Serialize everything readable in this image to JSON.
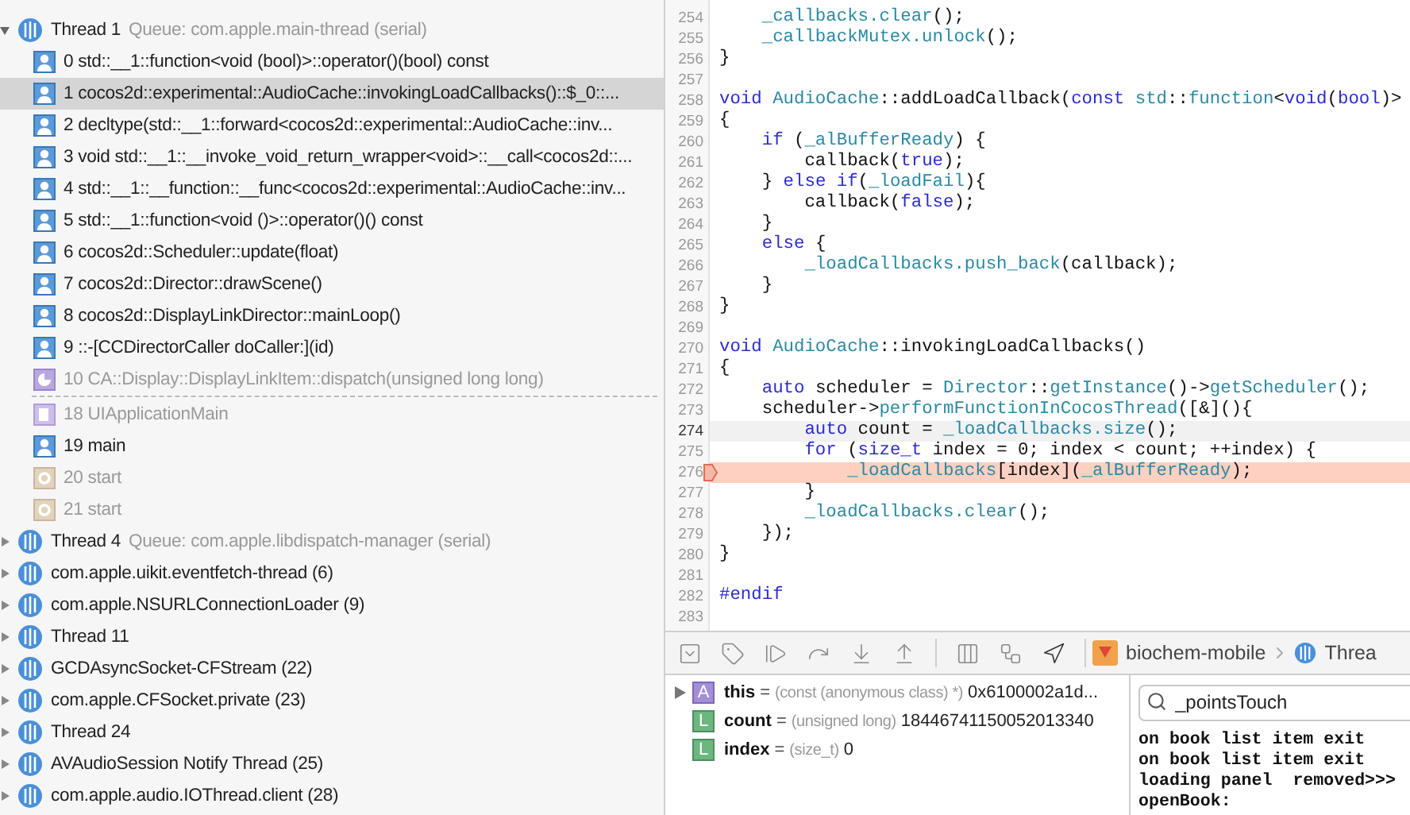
{
  "navigator": {
    "threads": [
      {
        "name": "Thread 1",
        "queue": "Queue: com.apple.main-thread (serial)",
        "expanded": true,
        "frames": [
          {
            "kind": "user",
            "label": "0 std::__1::function<void (bool)>::operator()(bool) const",
            "selected": false
          },
          {
            "kind": "user",
            "label": "1 cocos2d::experimental::AudioCache::invokingLoadCallbacks()::$_0::...",
            "selected": true
          },
          {
            "kind": "user",
            "label": "2 decltype(std::__1::forward<cocos2d::experimental::AudioCache::inv...",
            "selected": false
          },
          {
            "kind": "user",
            "label": "3 void std::__1::__invoke_void_return_wrapper<void>::__call<cocos2d::...",
            "selected": false
          },
          {
            "kind": "user",
            "label": "4 std::__1::__function::__func<cocos2d::experimental::AudioCache::inv...",
            "selected": false
          },
          {
            "kind": "user",
            "label": "5 std::__1::function<void ()>::operator()() const",
            "selected": false
          },
          {
            "kind": "user",
            "label": "6 cocos2d::Scheduler::update(float)",
            "selected": false
          },
          {
            "kind": "user",
            "label": "7 cocos2d::Director::drawScene()",
            "selected": false
          },
          {
            "kind": "user",
            "label": "8 cocos2d::DisplayLinkDirector::mainLoop()",
            "selected": false
          },
          {
            "kind": "user",
            "label": "9 ::-[CCDirectorCaller doCaller:](id)",
            "selected": false
          },
          {
            "kind": "quartz",
            "label": "10 CA::Display::DisplayLinkItem::dispatch(unsigned long long)",
            "selected": false
          },
          {
            "kind": "elision"
          },
          {
            "kind": "library",
            "label": "18 UIApplicationMain",
            "selected": false
          },
          {
            "kind": "user",
            "label": "19 main",
            "selected": false
          },
          {
            "kind": "system",
            "label": "20 start",
            "selected": false
          },
          {
            "kind": "system",
            "label": "21 start",
            "selected": false
          }
        ]
      },
      {
        "name": "Thread 4",
        "queue": "Queue: com.apple.libdispatch-manager (serial)",
        "expanded": false
      },
      {
        "name": "com.apple.uikit.eventfetch-thread (6)",
        "expanded": false
      },
      {
        "name": "com.apple.NSURLConnectionLoader (9)",
        "expanded": false
      },
      {
        "name": "Thread 11",
        "expanded": false
      },
      {
        "name": "GCDAsyncSocket-CFStream (22)",
        "expanded": false
      },
      {
        "name": "com.apple.CFSocket.private (23)",
        "expanded": false
      },
      {
        "name": "Thread 24",
        "expanded": false
      },
      {
        "name": "AVAudioSession Notify Thread (25)",
        "expanded": false
      },
      {
        "name": "com.apple.audio.IOThread.client (28)",
        "expanded": false
      }
    ]
  },
  "editor": {
    "lines": [
      {
        "number": "254",
        "current": false,
        "stopped": false,
        "parts": [
          {
            "text": "    _callbacks.clear",
            "kind": "symbol"
          },
          {
            "text": "();",
            "kind": "plain"
          }
        ]
      },
      {
        "number": "255",
        "current": false,
        "stopped": false,
        "parts": [
          {
            "text": "    _callbackMutex.unlock",
            "kind": "symbol"
          },
          {
            "text": "();",
            "kind": "plain"
          }
        ]
      },
      {
        "number": "256",
        "current": false,
        "stopped": false,
        "parts": [
          {
            "text": "}",
            "kind": "plain"
          }
        ]
      },
      {
        "number": "257",
        "current": false,
        "stopped": false
      },
      {
        "number": "258",
        "current": false,
        "stopped": false,
        "parts": [
          {
            "text": "void ",
            "kind": "keyword"
          },
          {
            "text": "AudioCache",
            "kind": "symbol"
          },
          {
            "text": "::addLoadCallback(",
            "kind": "plain"
          },
          {
            "text": "const ",
            "kind": "keyword"
          },
          {
            "text": "std",
            "kind": "symbol"
          },
          {
            "text": "::",
            "kind": "plain"
          },
          {
            "text": "function",
            "kind": "symbol"
          },
          {
            "text": "<",
            "kind": "plain"
          },
          {
            "text": "void",
            "kind": "keyword"
          },
          {
            "text": "(",
            "kind": "plain"
          },
          {
            "text": "bool",
            "kind": "keyword"
          },
          {
            "text": ")>",
            "kind": "plain"
          }
        ]
      },
      {
        "number": "259",
        "current": false,
        "stopped": false,
        "parts": [
          {
            "text": "{",
            "kind": "plain"
          }
        ]
      },
      {
        "number": "260",
        "current": false,
        "stopped": false,
        "parts": [
          {
            "text": "    if ",
            "kind": "keyword"
          },
          {
            "text": "(",
            "kind": "plain"
          },
          {
            "text": "_alBufferReady",
            "kind": "symbol"
          },
          {
            "text": ") {",
            "kind": "plain"
          }
        ]
      },
      {
        "number": "261",
        "current": false,
        "stopped": false,
        "parts": [
          {
            "text": "        callback(",
            "kind": "plain"
          },
          {
            "text": "true",
            "kind": "keyword"
          },
          {
            "text": ");",
            "kind": "plain"
          }
        ]
      },
      {
        "number": "262",
        "current": false,
        "stopped": false,
        "parts": [
          {
            "text": "    } ",
            "kind": "plain"
          },
          {
            "text": "else if",
            "kind": "keyword"
          },
          {
            "text": "(",
            "kind": "plain"
          },
          {
            "text": "_loadFail",
            "kind": "symbol"
          },
          {
            "text": "){",
            "kind": "plain"
          }
        ]
      },
      {
        "number": "263",
        "current": false,
        "stopped": false,
        "parts": [
          {
            "text": "        callback(",
            "kind": "plain"
          },
          {
            "text": "false",
            "kind": "keyword"
          },
          {
            "text": ");",
            "kind": "plain"
          }
        ]
      },
      {
        "number": "264",
        "current": false,
        "stopped": false,
        "parts": [
          {
            "text": "    }",
            "kind": "plain"
          }
        ]
      },
      {
        "number": "265",
        "current": false,
        "stopped": false,
        "parts": [
          {
            "text": "    else ",
            "kind": "keyword"
          },
          {
            "text": "{",
            "kind": "plain"
          }
        ]
      },
      {
        "number": "266",
        "current": false,
        "stopped": false,
        "parts": [
          {
            "text": "        _loadCallbacks.push_back",
            "kind": "symbol"
          },
          {
            "text": "(callback);",
            "kind": "plain"
          }
        ]
      },
      {
        "number": "267",
        "current": false,
        "stopped": false,
        "parts": [
          {
            "text": "    }",
            "kind": "plain"
          }
        ]
      },
      {
        "number": "268",
        "current": false,
        "stopped": false,
        "parts": [
          {
            "text": "}",
            "kind": "plain"
          }
        ]
      },
      {
        "number": "269",
        "current": false,
        "stopped": false
      },
      {
        "number": "270",
        "current": false,
        "stopped": false,
        "parts": [
          {
            "text": "void ",
            "kind": "keyword"
          },
          {
            "text": "AudioCache",
            "kind": "symbol"
          },
          {
            "text": "::invokingLoadCallbacks()",
            "kind": "plain"
          }
        ]
      },
      {
        "number": "271",
        "current": false,
        "stopped": false,
        "parts": [
          {
            "text": "{",
            "kind": "plain"
          }
        ]
      },
      {
        "number": "272",
        "current": false,
        "stopped": false,
        "parts": [
          {
            "text": "    auto ",
            "kind": "keyword"
          },
          {
            "text": "scheduler = ",
            "kind": "plain"
          },
          {
            "text": "Director",
            "kind": "symbol"
          },
          {
            "text": "::",
            "kind": "plain"
          },
          {
            "text": "getInstance",
            "kind": "symbol"
          },
          {
            "text": "()->",
            "kind": "plain"
          },
          {
            "text": "getScheduler",
            "kind": "symbol"
          },
          {
            "text": "();",
            "kind": "plain"
          }
        ]
      },
      {
        "number": "273",
        "current": false,
        "stopped": false,
        "parts": [
          {
            "text": "    scheduler->",
            "kind": "plain"
          },
          {
            "text": "performFunctionInCocosThread",
            "kind": "symbol"
          },
          {
            "text": "([&](){",
            "kind": "plain"
          }
        ]
      },
      {
        "number": "274",
        "current": true,
        "stopped": false,
        "parts": [
          {
            "text": "        auto ",
            "kind": "keyword"
          },
          {
            "text": "count = ",
            "kind": "plain"
          },
          {
            "text": "_loadCallbacks.size",
            "kind": "symbol"
          },
          {
            "text": "();",
            "kind": "plain"
          }
        ]
      },
      {
        "number": "275",
        "current": false,
        "stopped": false,
        "parts": [
          {
            "text": "        for ",
            "kind": "keyword"
          },
          {
            "text": "(",
            "kind": "plain"
          },
          {
            "text": "size_t",
            "kind": "keyword"
          },
          {
            "text": " index = 0; index < count; ++index) {",
            "kind": "plain"
          }
        ]
      },
      {
        "number": "276",
        "current": false,
        "stopped": true,
        "parts": [
          {
            "text": "            _loadCallbacks",
            "kind": "symbol"
          },
          {
            "text": "[index](",
            "kind": "plain"
          },
          {
            "text": "_alBufferReady",
            "kind": "symbol"
          },
          {
            "text": ");",
            "kind": "plain"
          }
        ]
      },
      {
        "number": "277",
        "current": false,
        "stopped": false,
        "parts": [
          {
            "text": "        }",
            "kind": "plain"
          }
        ]
      },
      {
        "number": "278",
        "current": false,
        "stopped": false,
        "parts": [
          {
            "text": "        _loadCallbacks.clear",
            "kind": "symbol"
          },
          {
            "text": "();",
            "kind": "plain"
          }
        ]
      },
      {
        "number": "279",
        "current": false,
        "stopped": false,
        "parts": [
          {
            "text": "    });",
            "kind": "plain"
          }
        ]
      },
      {
        "number": "280",
        "current": false,
        "stopped": false,
        "parts": [
          {
            "text": "}",
            "kind": "plain"
          }
        ]
      },
      {
        "number": "281",
        "current": false,
        "stopped": false
      },
      {
        "number": "282",
        "current": false,
        "stopped": false,
        "parts": [
          {
            "text": "#endif",
            "kind": "keyword"
          }
        ]
      },
      {
        "number": "283",
        "current": false,
        "stopped": false
      }
    ]
  },
  "debug_bar": {
    "buttons": [
      {
        "kind": "console"
      },
      {
        "kind": "breakpoints"
      },
      {
        "kind": "continue"
      },
      {
        "kind": "step_over"
      },
      {
        "kind": "step_into"
      },
      {
        "kind": "step_out"
      },
      {
        "kind": "divider"
      },
      {
        "kind": "view_debugger"
      },
      {
        "kind": "memory_graph"
      },
      {
        "kind": "location"
      }
    ],
    "path": [
      {
        "kind": "app",
        "label": "biochem-mobile"
      },
      {
        "kind": "thread",
        "label": "Threa"
      }
    ]
  },
  "variables": [
    {
      "badge": "A",
      "kind": "argument",
      "expandable": true,
      "name": "this",
      "equals": "=",
      "type": "(const (anonymous class) *)",
      "value": "0x6100002a1d..."
    },
    {
      "badge": "L",
      "kind": "local",
      "expandable": false,
      "name": "count",
      "equals": "=",
      "type": "(unsigned long)",
      "value": "18446741150052013340"
    },
    {
      "badge": "L",
      "kind": "local",
      "expandable": false,
      "name": "index",
      "equals": "=",
      "type": "(size_t)",
      "value": "0"
    }
  ],
  "console": {
    "filter": {
      "value": "_pointsTouch"
    },
    "lines": [
      "on book list item exit",
      "on book list item exit",
      "loading panel  removed>>>",
      "openBook:"
    ]
  }
}
